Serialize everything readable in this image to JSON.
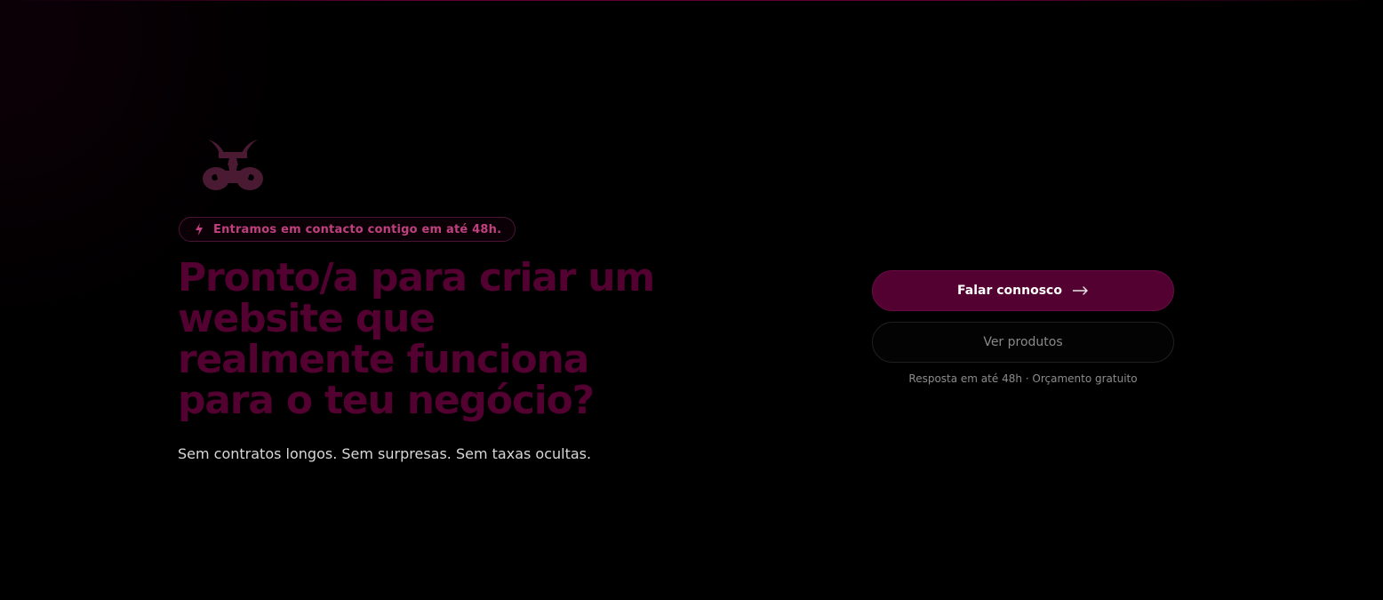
{
  "colors": {
    "background": "#000000",
    "accent": "#520131",
    "logo": "#4a1a33",
    "badge_text": "#c0407f"
  },
  "hero": {
    "logo_icon": "brand-logo-icon",
    "badge": {
      "icon": "lightning-icon",
      "text": "Entramos em contacto contigo em até 48h."
    },
    "headline": "Pronto/a para criar um website que realmente funciona para o teu negócio?",
    "subtext": "Sem contratos longos. Sem surpresas. Sem taxas ocultas."
  },
  "cta": {
    "primary_label": "Falar connosco",
    "primary_icon": "arrow-right-icon",
    "secondary_label": "Ver produtos",
    "note": "Resposta em até 48h · Orçamento gratuito"
  }
}
